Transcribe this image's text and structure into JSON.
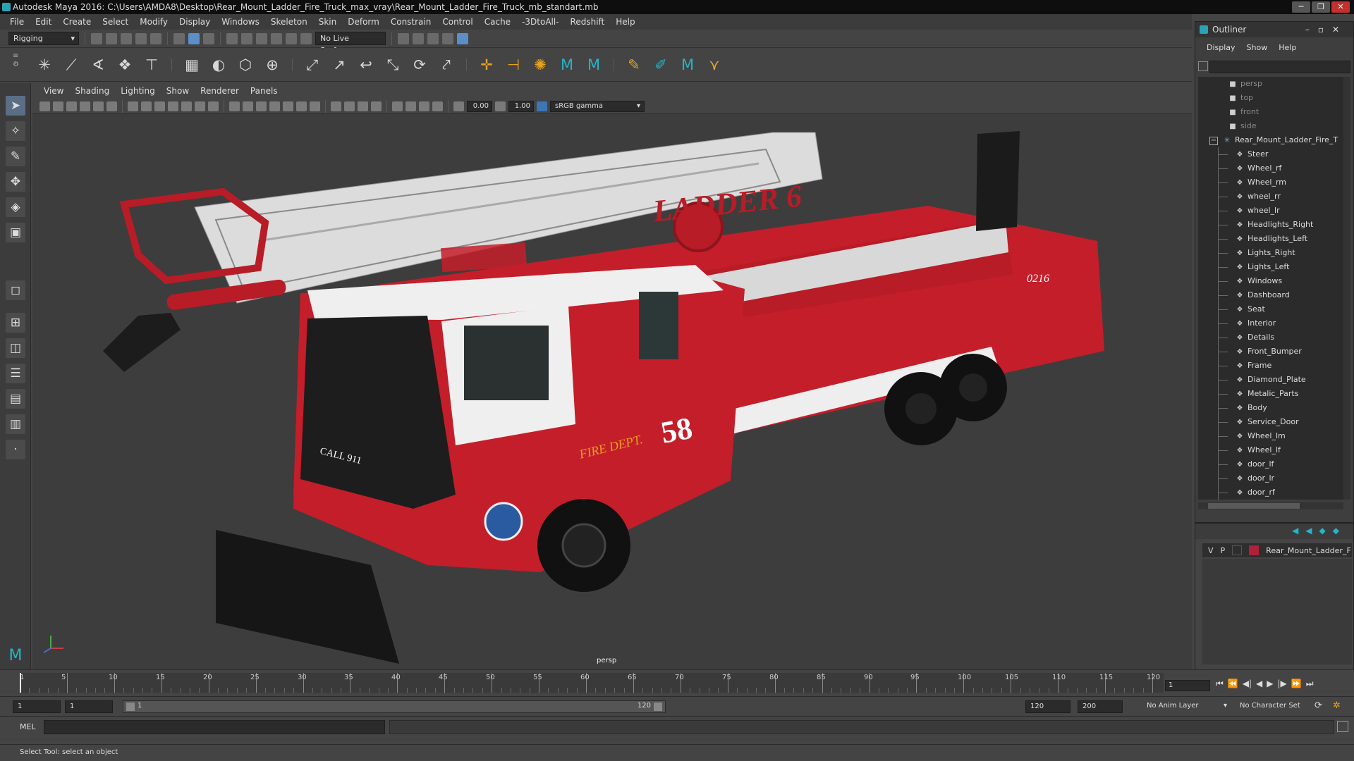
{
  "window": {
    "title": "Autodesk Maya 2016: C:\\Users\\AMDA8\\Desktop\\Rear_Mount_Ladder_Fire_Truck_max_vray\\Rear_Mount_Ladder_Fire_Truck_mb_standart.mb"
  },
  "menubar": [
    "File",
    "Edit",
    "Create",
    "Select",
    "Modify",
    "Display",
    "Windows",
    "Skeleton",
    "Skin",
    "Deform",
    "Constrain",
    "Control",
    "Cache",
    "-3DtoAll-",
    "Redshift",
    "Help"
  ],
  "toolbar": {
    "mode": "Rigging",
    "live_surface": "No Live Surface"
  },
  "panel": {
    "menu": [
      "View",
      "Shading",
      "Lighting",
      "Show",
      "Renderer",
      "Panels"
    ],
    "exposure": "0.00",
    "gamma": "1.00",
    "colorspace": "sRGB gamma",
    "camera": "persp"
  },
  "scene": {
    "ladder_text": "LADDER 6",
    "unit_number": "58",
    "door_text": "FIRE DEPT.",
    "call_text": "CALL 911",
    "rear_number": "0216"
  },
  "outliner": {
    "title": "Outliner",
    "menu": [
      "Display",
      "Show",
      "Help"
    ],
    "cameras": [
      "persp",
      "top",
      "front",
      "side"
    ],
    "root": "Rear_Mount_Ladder_Fire_T",
    "children": [
      "Steer",
      "Wheel_rf",
      "Wheel_rm",
      "wheel_rr",
      "wheel_lr",
      "Headlights_Right",
      "Headlights_Left",
      "Lights_Right",
      "Lights_Left",
      "Windows",
      "Dashboard",
      "Seat",
      "Interior",
      "Details",
      "Front_Bumper",
      "Frame",
      "Diamond_Plate",
      "Metalic_Parts",
      "Body",
      "Service_Door",
      "Wheel_lm",
      "Wheel_lf",
      "door_lf",
      "door_lr",
      "door_rf"
    ]
  },
  "layers": {
    "v": "V",
    "p": "P",
    "name": "Rear_Mount_Ladder_F",
    "color": "#b0203a"
  },
  "timeline": {
    "ticks": [
      5,
      10,
      15,
      20,
      25,
      30,
      35,
      40,
      45,
      50,
      55,
      60,
      65,
      70,
      75,
      80,
      85,
      90,
      95,
      100,
      105,
      110,
      115,
      120
    ],
    "start_label": "1",
    "current_frame": "1"
  },
  "range": {
    "start": "1",
    "playback_start": "1",
    "slider_start": "1",
    "slider_end": "120",
    "playback_end": "120",
    "end": "200",
    "anim_layer": "No Anim Layer",
    "char_set": "No Character Set"
  },
  "cmd": {
    "label": "MEL"
  },
  "status": {
    "text": "Select Tool: select an object"
  }
}
